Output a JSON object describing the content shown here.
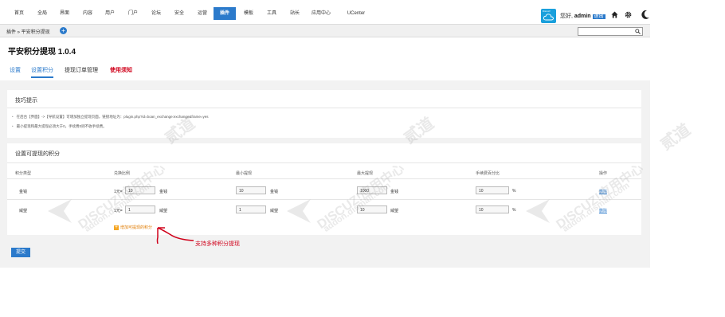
{
  "nav": {
    "items": [
      "首页",
      "全局",
      "界面",
      "内容",
      "用户",
      "门户",
      "论坛",
      "安全",
      "运营",
      "插件",
      "模板",
      "工具",
      "站长",
      "应用中心",
      "UCenter"
    ],
    "active_index": 9,
    "cloud_label": "Discuz!",
    "greeting": "您好, ",
    "username": "admin",
    "logout": "退出"
  },
  "subheader": {
    "breadcrumb": "插件 » 平安积分提现",
    "search_placeholder": ""
  },
  "page": {
    "title": "平安积分提现 1.0.4",
    "tabs": [
      "设置",
      "设置积分",
      "提现订单管理",
      "使用须知"
    ],
    "active_tab": 1
  },
  "tips": {
    "title": "技巧提示",
    "items": [
      "在后台【界面】->【导航设置】可增加独立提现页面，链接地址为：plugin.php?id=boan_exchange:exchange&frame=yes",
      "最小提现和最大提现必须大于0，手续费0则不收手续费。"
    ]
  },
  "credits": {
    "title": "设置可提现的积分",
    "headers": [
      "积分类型",
      "兑换比例",
      "最小提现",
      "最大提现",
      "手续费百分比",
      "操作"
    ],
    "rows": [
      {
        "type": "金钱",
        "rate_prefix": "1元=",
        "rate": "10",
        "rate_unit": "金钱",
        "min": "10",
        "min_unit": "金钱",
        "max": "1000",
        "max_unit": "金钱",
        "fee": "10",
        "fee_unit": "%",
        "action": "删除"
      },
      {
        "type": "威望",
        "rate_prefix": "1元=",
        "rate": "1",
        "rate_unit": "威望",
        "min": "1",
        "min_unit": "威望",
        "max": "10",
        "max_unit": "威望",
        "fee": "10",
        "fee_unit": "%",
        "action": "删除"
      }
    ],
    "add_label": "增加可提现的积分"
  },
  "submit_label": "提交",
  "annotation": "支持多种积分提现",
  "watermark": {
    "brand": "DISCUZ!应用中心",
    "sub": "addon.dismall.com",
    "mark": "贰道"
  },
  "colors": {
    "accent": "#2b7acb",
    "warning": "#d0021b",
    "add": "#f5a623"
  }
}
